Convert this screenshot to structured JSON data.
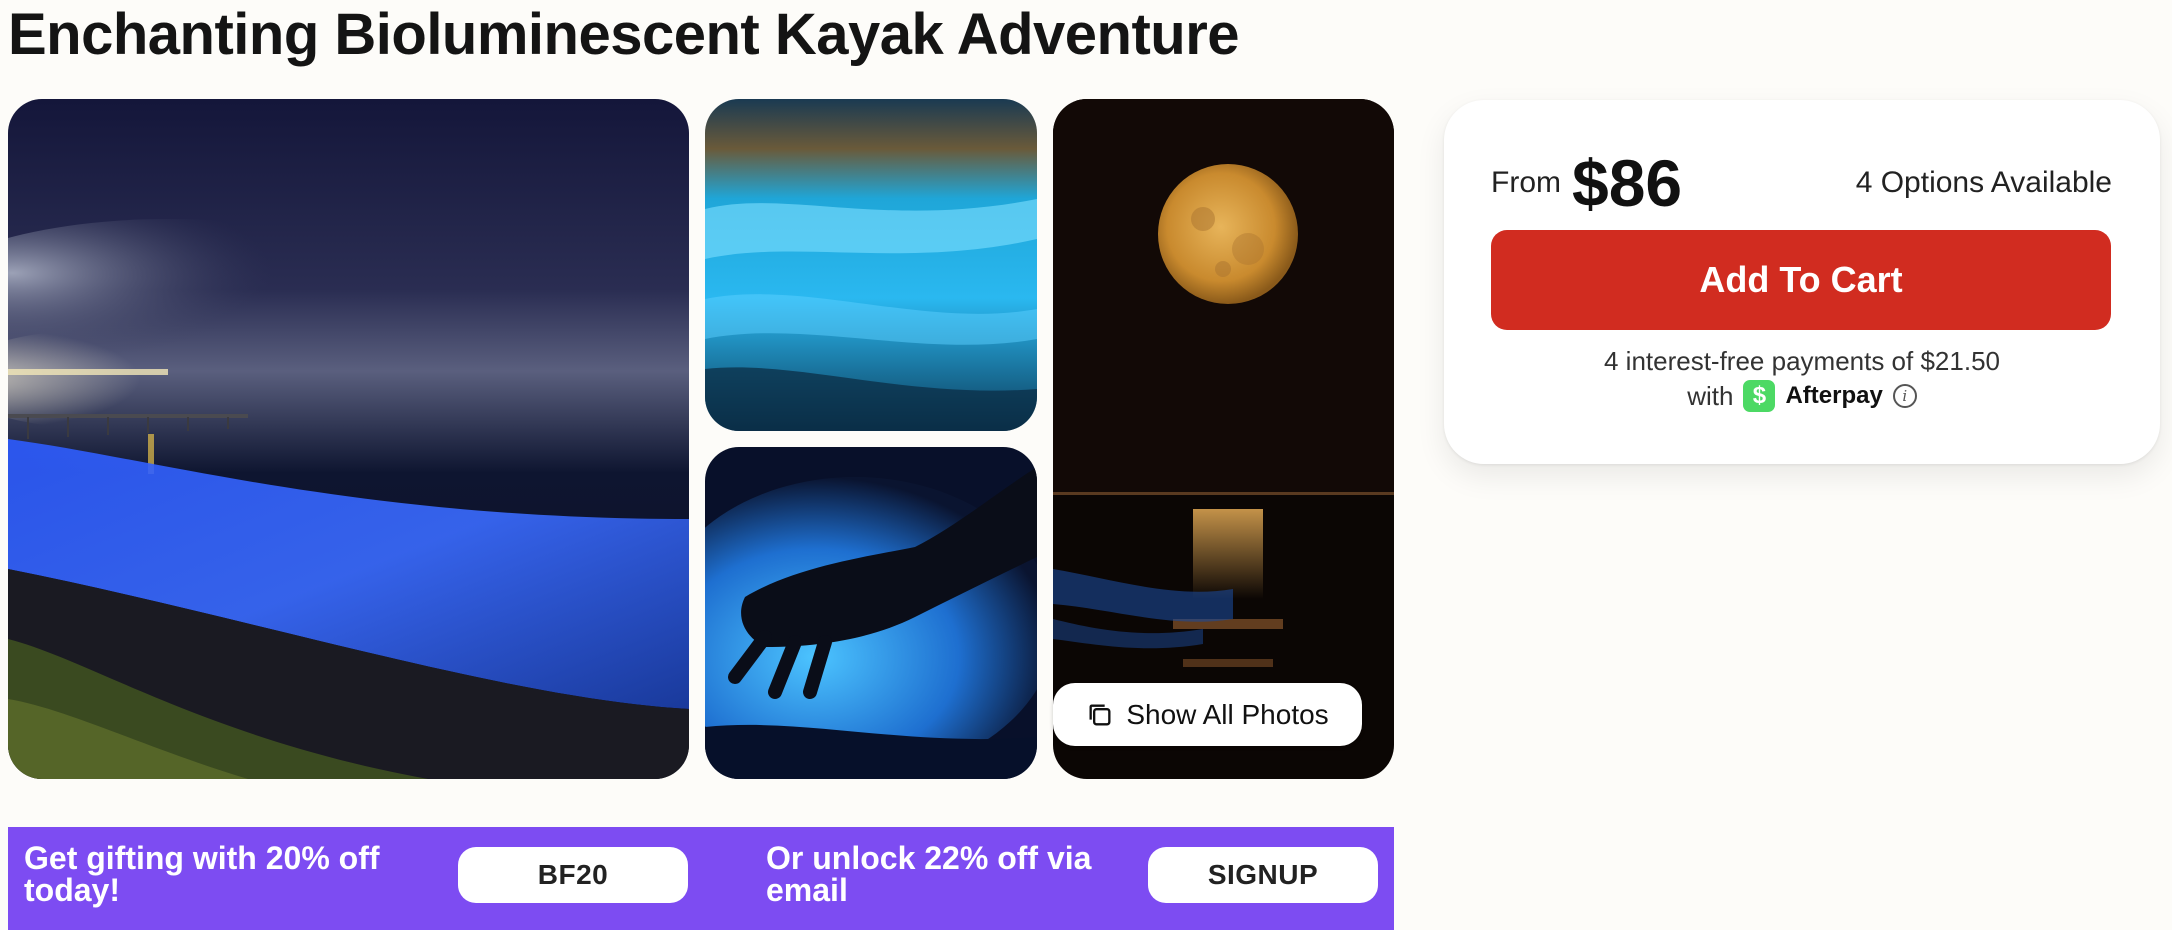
{
  "page_title": "Enchanting Bioluminescent Kayak Adventure",
  "gallery": {
    "show_all_label": "Show All Photos",
    "photos": [
      {
        "name": "bioluminescent-shoreline-pier"
      },
      {
        "name": "glowing-wave"
      },
      {
        "name": "glowing-hand-in-water"
      },
      {
        "name": "full-moon-over-ocean"
      }
    ]
  },
  "promo": {
    "offer1_text": "Get gifting with 20% off today!",
    "offer1_code": "BF20",
    "offer2_text": "Or unlock 22% off via email",
    "offer2_code": "SIGNUP",
    "background_color": "#7d4cf2"
  },
  "booking": {
    "from_label": "From",
    "price": "$86",
    "options_text": "4 Options Available",
    "add_to_cart_label": "Add To Cart",
    "installments_text": "4 interest-free payments of $21.50",
    "with_label": "with",
    "afterpay_logo_glyph": "$",
    "afterpay_name": "Afterpay",
    "accent_color": "#d12c20"
  }
}
